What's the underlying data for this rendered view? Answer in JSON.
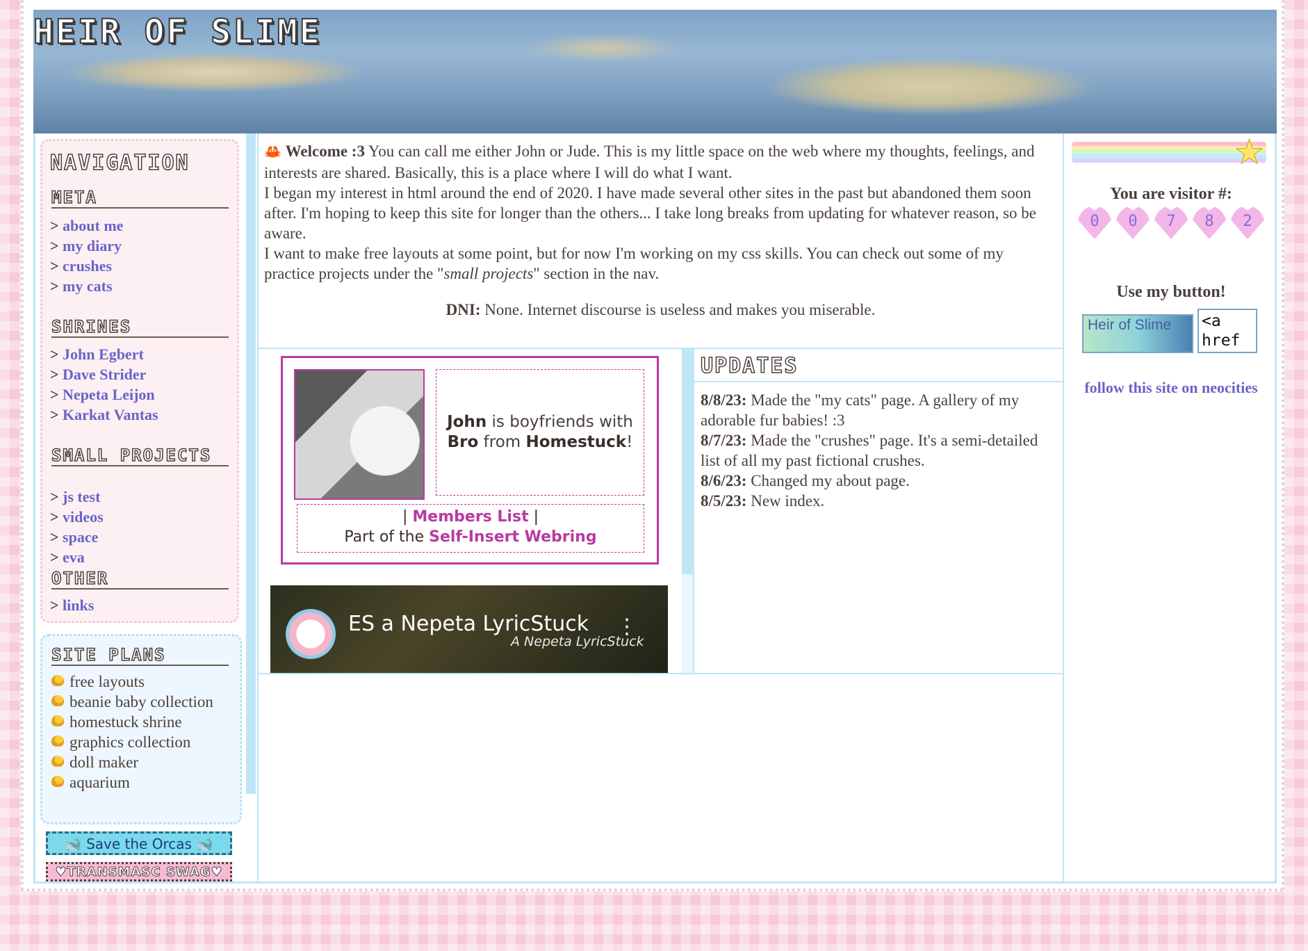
{
  "site": {
    "title": "HEIR OF SLIME"
  },
  "nav": {
    "title": "NAVIGATION",
    "sections": [
      {
        "heading": "META",
        "items": [
          "about me",
          "my diary",
          "crushes",
          "my cats"
        ]
      },
      {
        "heading": "SHRINES",
        "items": [
          "John Egbert",
          "Dave Strider",
          "Nepeta Leijon",
          "Karkat Vantas"
        ]
      },
      {
        "heading": "SMALL PROJECTS",
        "items": [
          "js test",
          "videos",
          "space",
          "eva"
        ]
      },
      {
        "heading": "OTHER",
        "items": [
          "links"
        ]
      }
    ],
    "prefix": ">"
  },
  "site_plans": {
    "heading": "SITE PLANS",
    "items": [
      "free layouts",
      "beanie baby collection",
      "homestuck shrine",
      "graphics collection",
      "doll maker",
      "aquarium"
    ]
  },
  "stamps": {
    "orcas": "Save the Orcas",
    "transmasc": "♥TRANSMASC SWAG♥"
  },
  "welcome": {
    "lead": "Welcome :3",
    "p1": "You can call me either John or Jude. This is my little space on the web where my thoughts, feelings, and interests are shared. Basically, this is a place where I will do what I want.",
    "p2": "I began my interest in html around the end of 2020. I have made several other sites in the past but abandoned them soon after. I'm hoping to keep this site for longer than the others... I take long breaks from updating for whatever reason, so be aware.",
    "p3_pre": "I want to make free layouts at some point, but for now I'm working on my css skills. You can check out some of my practice projects under the \"",
    "p3_em": "small projects",
    "p3_post": "\" section in the nav.",
    "dni_label": "DNI:",
    "dni_text": "None. Internet discourse is useless and makes you miserable."
  },
  "webring": {
    "name1": "John",
    "mid1": "is boyfriends with",
    "name2": "Bro",
    "mid2": "from",
    "fandom": "Homestuck",
    "end": "!",
    "members": "Members List",
    "part_of": "Part of the",
    "ring": "Self-Insert Webring"
  },
  "video": {
    "title": "ES a Nepeta LyricStuck",
    "overlay": "A Nepeta LyricStuck",
    "overlay_big": "ES"
  },
  "updates": {
    "heading": "UPDATES",
    "entries": [
      {
        "date": "8/8/23:",
        "text": "Made the \"my cats\" page. A gallery of my adorable fur babies! :3"
      },
      {
        "date": "8/7/23:",
        "text": "Made the \"crushes\" page. It's a semi-detailed list of all my past fictional crushes."
      },
      {
        "date": "8/6/23:",
        "text": "Changed my about page."
      },
      {
        "date": "8/5/23:",
        "text": "New index."
      }
    ]
  },
  "sidebar_right": {
    "visitor_label": "You are visitor #:",
    "visitor_digits": [
      "0",
      "0",
      "7",
      "8",
      "2"
    ],
    "button_label": "Use my button!",
    "button_text": "Heir of Slime",
    "code_snippet": "<a\nhref",
    "neocities": "follow this site on neocities"
  },
  "colors": {
    "accent_link": "#6a63c9",
    "webring": "#b93aa0",
    "border_blue": "#bfe6f7",
    "bg_pink": "#f7c9d9"
  }
}
